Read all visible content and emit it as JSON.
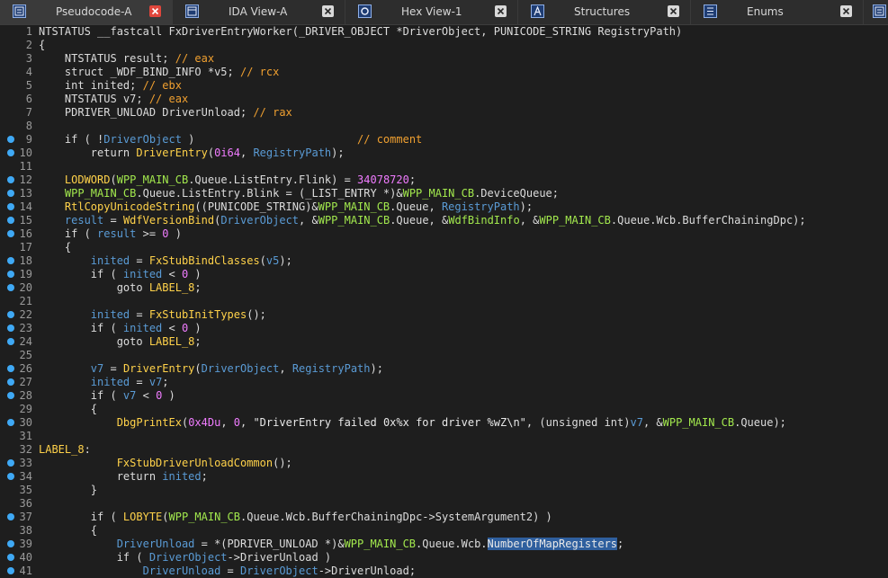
{
  "tabs": [
    {
      "label": "Pseudocode-A",
      "icon": "pseudocode-icon",
      "active": true
    },
    {
      "label": "IDA View-A",
      "icon": "ida-view-icon",
      "active": false
    },
    {
      "label": "Hex View-1",
      "icon": "hex-view-icon",
      "active": false
    },
    {
      "label": "Structures",
      "icon": "structures-icon",
      "active": false
    },
    {
      "label": "Enums",
      "icon": "enums-icon",
      "active": false
    }
  ],
  "colors": {
    "keyword": "#5a9bd5",
    "function": "#ffd24a",
    "global": "#a2e84d",
    "number": "#f07cff",
    "comment": "#f0a030",
    "selection": "#2f5f9e",
    "breakpoint": "#3fa9f5"
  },
  "lines": [
    {
      "n": "1",
      "bp": false,
      "tokens": [
        [
          "t",
          "NTSTATUS __fastcall FxDriverEntryWorker(_DRIVER_OBJECT *DriverObject, PUNICODE_STRING RegistryPath)"
        ]
      ]
    },
    {
      "n": "2",
      "bp": false,
      "tokens": [
        [
          "p",
          "{"
        ]
      ]
    },
    {
      "n": "3",
      "bp": false,
      "tokens": [
        [
          "t",
          "    NTSTATUS result; "
        ],
        [
          "c",
          "// eax"
        ]
      ]
    },
    {
      "n": "4",
      "bp": false,
      "tokens": [
        [
          "t",
          "    struct _WDF_BIND_INFO *v5; "
        ],
        [
          "c",
          "// rcx"
        ]
      ]
    },
    {
      "n": "5",
      "bp": false,
      "tokens": [
        [
          "t",
          "    int inited; "
        ],
        [
          "c",
          "// ebx"
        ]
      ]
    },
    {
      "n": "6",
      "bp": false,
      "tokens": [
        [
          "t",
          "    NTSTATUS v7; "
        ],
        [
          "c",
          "// eax"
        ]
      ]
    },
    {
      "n": "7",
      "bp": false,
      "tokens": [
        [
          "t",
          "    PDRIVER_UNLOAD DriverUnload; "
        ],
        [
          "c",
          "// rax"
        ]
      ]
    },
    {
      "n": "8",
      "bp": false,
      "tokens": []
    },
    {
      "n": "9",
      "bp": true,
      "tokens": [
        [
          "p",
          "    if ( !"
        ],
        [
          "v",
          "DriverObject"
        ],
        [
          "p",
          " )"
        ],
        [
          "p",
          "                         "
        ],
        [
          "c",
          "// comment"
        ]
      ]
    },
    {
      "n": "10",
      "bp": true,
      "tokens": [
        [
          "p",
          "        return "
        ],
        [
          "f",
          "DriverEntry"
        ],
        [
          "p",
          "("
        ],
        [
          "n",
          "0i64"
        ],
        [
          "p",
          ", "
        ],
        [
          "v",
          "RegistryPath"
        ],
        [
          "p",
          ");"
        ]
      ]
    },
    {
      "n": "11",
      "bp": false,
      "tokens": []
    },
    {
      "n": "12",
      "bp": true,
      "tokens": [
        [
          "f",
          "    LODWORD"
        ],
        [
          "p",
          "("
        ],
        [
          "g",
          "WPP_MAIN_CB"
        ],
        [
          "p",
          ".Queue.ListEntry.Flink) = "
        ],
        [
          "n",
          "34078720"
        ],
        [
          "p",
          ";"
        ]
      ]
    },
    {
      "n": "13",
      "bp": true,
      "tokens": [
        [
          "g",
          "    WPP_MAIN_CB"
        ],
        [
          "p",
          ".Queue.ListEntry.Blink = (_LIST_ENTRY *)&"
        ],
        [
          "g",
          "WPP_MAIN_CB"
        ],
        [
          "p",
          ".DeviceQueue;"
        ]
      ]
    },
    {
      "n": "14",
      "bp": true,
      "tokens": [
        [
          "f",
          "    RtlCopyUnicodeString"
        ],
        [
          "p",
          "((PUNICODE_STRING)&"
        ],
        [
          "g",
          "WPP_MAIN_CB"
        ],
        [
          "p",
          ".Queue, "
        ],
        [
          "v",
          "RegistryPath"
        ],
        [
          "p",
          ");"
        ]
      ]
    },
    {
      "n": "15",
      "bp": true,
      "tokens": [
        [
          "v",
          "    result"
        ],
        [
          "p",
          " = "
        ],
        [
          "f",
          "WdfVersionBind"
        ],
        [
          "p",
          "("
        ],
        [
          "v",
          "DriverObject"
        ],
        [
          "p",
          ", &"
        ],
        [
          "g",
          "WPP_MAIN_CB"
        ],
        [
          "p",
          ".Queue, &"
        ],
        [
          "g",
          "WdfBindInfo"
        ],
        [
          "p",
          ", &"
        ],
        [
          "g",
          "WPP_MAIN_CB"
        ],
        [
          "p",
          ".Queue.Wcb.BufferChainingDpc);"
        ]
      ]
    },
    {
      "n": "16",
      "bp": true,
      "tokens": [
        [
          "p",
          "    if ( "
        ],
        [
          "v",
          "result"
        ],
        [
          "p",
          " >= "
        ],
        [
          "n",
          "0"
        ],
        [
          "p",
          " )"
        ]
      ]
    },
    {
      "n": "17",
      "bp": false,
      "tokens": [
        [
          "p",
          "    {"
        ]
      ]
    },
    {
      "n": "18",
      "bp": true,
      "tokens": [
        [
          "v",
          "        inited"
        ],
        [
          "p",
          " = "
        ],
        [
          "f",
          "FxStubBindClasses"
        ],
        [
          "p",
          "("
        ],
        [
          "v",
          "v5"
        ],
        [
          "p",
          ");"
        ]
      ]
    },
    {
      "n": "19",
      "bp": true,
      "tokens": [
        [
          "p",
          "        if ( "
        ],
        [
          "v",
          "inited"
        ],
        [
          "p",
          " < "
        ],
        [
          "n",
          "0"
        ],
        [
          "p",
          " )"
        ]
      ]
    },
    {
      "n": "20",
      "bp": true,
      "tokens": [
        [
          "p",
          "            goto "
        ],
        [
          "l",
          "LABEL_8"
        ],
        [
          "p",
          ";"
        ]
      ]
    },
    {
      "n": "21",
      "bp": false,
      "tokens": []
    },
    {
      "n": "22",
      "bp": true,
      "tokens": [
        [
          "v",
          "        inited"
        ],
        [
          "p",
          " = "
        ],
        [
          "f",
          "FxStubInitTypes"
        ],
        [
          "p",
          "();"
        ]
      ]
    },
    {
      "n": "23",
      "bp": true,
      "tokens": [
        [
          "p",
          "        if ( "
        ],
        [
          "v",
          "inited"
        ],
        [
          "p",
          " < "
        ],
        [
          "n",
          "0"
        ],
        [
          "p",
          " )"
        ]
      ]
    },
    {
      "n": "24",
      "bp": true,
      "tokens": [
        [
          "p",
          "            goto "
        ],
        [
          "l",
          "LABEL_8"
        ],
        [
          "p",
          ";"
        ]
      ]
    },
    {
      "n": "25",
      "bp": false,
      "tokens": []
    },
    {
      "n": "26",
      "bp": true,
      "tokens": [
        [
          "v",
          "        v7"
        ],
        [
          "p",
          " = "
        ],
        [
          "f",
          "DriverEntry"
        ],
        [
          "p",
          "("
        ],
        [
          "v",
          "DriverObject"
        ],
        [
          "p",
          ", "
        ],
        [
          "v",
          "RegistryPath"
        ],
        [
          "p",
          ");"
        ]
      ]
    },
    {
      "n": "27",
      "bp": true,
      "tokens": [
        [
          "v",
          "        inited"
        ],
        [
          "p",
          " = "
        ],
        [
          "v",
          "v7"
        ],
        [
          "p",
          ";"
        ]
      ]
    },
    {
      "n": "28",
      "bp": true,
      "tokens": [
        [
          "p",
          "        if ( "
        ],
        [
          "v",
          "v7"
        ],
        [
          "p",
          " < "
        ],
        [
          "n",
          "0"
        ],
        [
          "p",
          " )"
        ]
      ]
    },
    {
      "n": "29",
      "bp": false,
      "tokens": [
        [
          "p",
          "        {"
        ]
      ]
    },
    {
      "n": "30",
      "bp": true,
      "tokens": [
        [
          "f",
          "            DbgPrintEx"
        ],
        [
          "p",
          "("
        ],
        [
          "n",
          "0x4Du"
        ],
        [
          "p",
          ", "
        ],
        [
          "n",
          "0"
        ],
        [
          "p",
          ", "
        ],
        [
          "s",
          "\"DriverEntry failed 0x%x for driver %wZ\\n\""
        ],
        [
          "p",
          ", (unsigned int)"
        ],
        [
          "v",
          "v7"
        ],
        [
          "p",
          ", &"
        ],
        [
          "g",
          "WPP_MAIN_CB"
        ],
        [
          "p",
          ".Queue);"
        ]
      ]
    },
    {
      "n": "31",
      "bp": false,
      "tokens": []
    },
    {
      "n": "32",
      "bp": false,
      "tokens": [
        [
          "l",
          "LABEL_8"
        ],
        [
          "p",
          ":"
        ]
      ]
    },
    {
      "n": "33",
      "bp": true,
      "tokens": [
        [
          "f",
          "            FxStubDriverUnloadCommon"
        ],
        [
          "p",
          "();"
        ]
      ]
    },
    {
      "n": "34",
      "bp": true,
      "tokens": [
        [
          "p",
          "            return "
        ],
        [
          "v",
          "inited"
        ],
        [
          "p",
          ";"
        ]
      ]
    },
    {
      "n": "35",
      "bp": false,
      "tokens": [
        [
          "p",
          "        }"
        ]
      ]
    },
    {
      "n": "36",
      "bp": false,
      "tokens": []
    },
    {
      "n": "37",
      "bp": true,
      "tokens": [
        [
          "p",
          "        if ( "
        ],
        [
          "f",
          "LOBYTE"
        ],
        [
          "p",
          "("
        ],
        [
          "g",
          "WPP_MAIN_CB"
        ],
        [
          "p",
          ".Queue.Wcb.BufferChainingDpc->SystemArgument2) )"
        ]
      ]
    },
    {
      "n": "38",
      "bp": false,
      "tokens": [
        [
          "p",
          "        {"
        ]
      ]
    },
    {
      "n": "39",
      "bp": true,
      "tokens": [
        [
          "v",
          "            DriverUnload"
        ],
        [
          "p",
          " = *(PDRIVER_UNLOAD *)&"
        ],
        [
          "g",
          "WPP_MAIN_CB"
        ],
        [
          "p",
          ".Queue.Wcb."
        ],
        [
          "sel",
          "NumberOfMapRegisters"
        ],
        [
          "p",
          ";"
        ]
      ]
    },
    {
      "n": "40",
      "bp": true,
      "tokens": [
        [
          "p",
          "            if ( "
        ],
        [
          "v",
          "DriverObject"
        ],
        [
          "p",
          "->DriverUnload )"
        ]
      ]
    },
    {
      "n": "41",
      "bp": true,
      "tokens": [
        [
          "v",
          "                DriverUnload"
        ],
        [
          "p",
          " = "
        ],
        [
          "v",
          "DriverObject"
        ],
        [
          "p",
          "->DriverUnload;"
        ]
      ]
    }
  ]
}
